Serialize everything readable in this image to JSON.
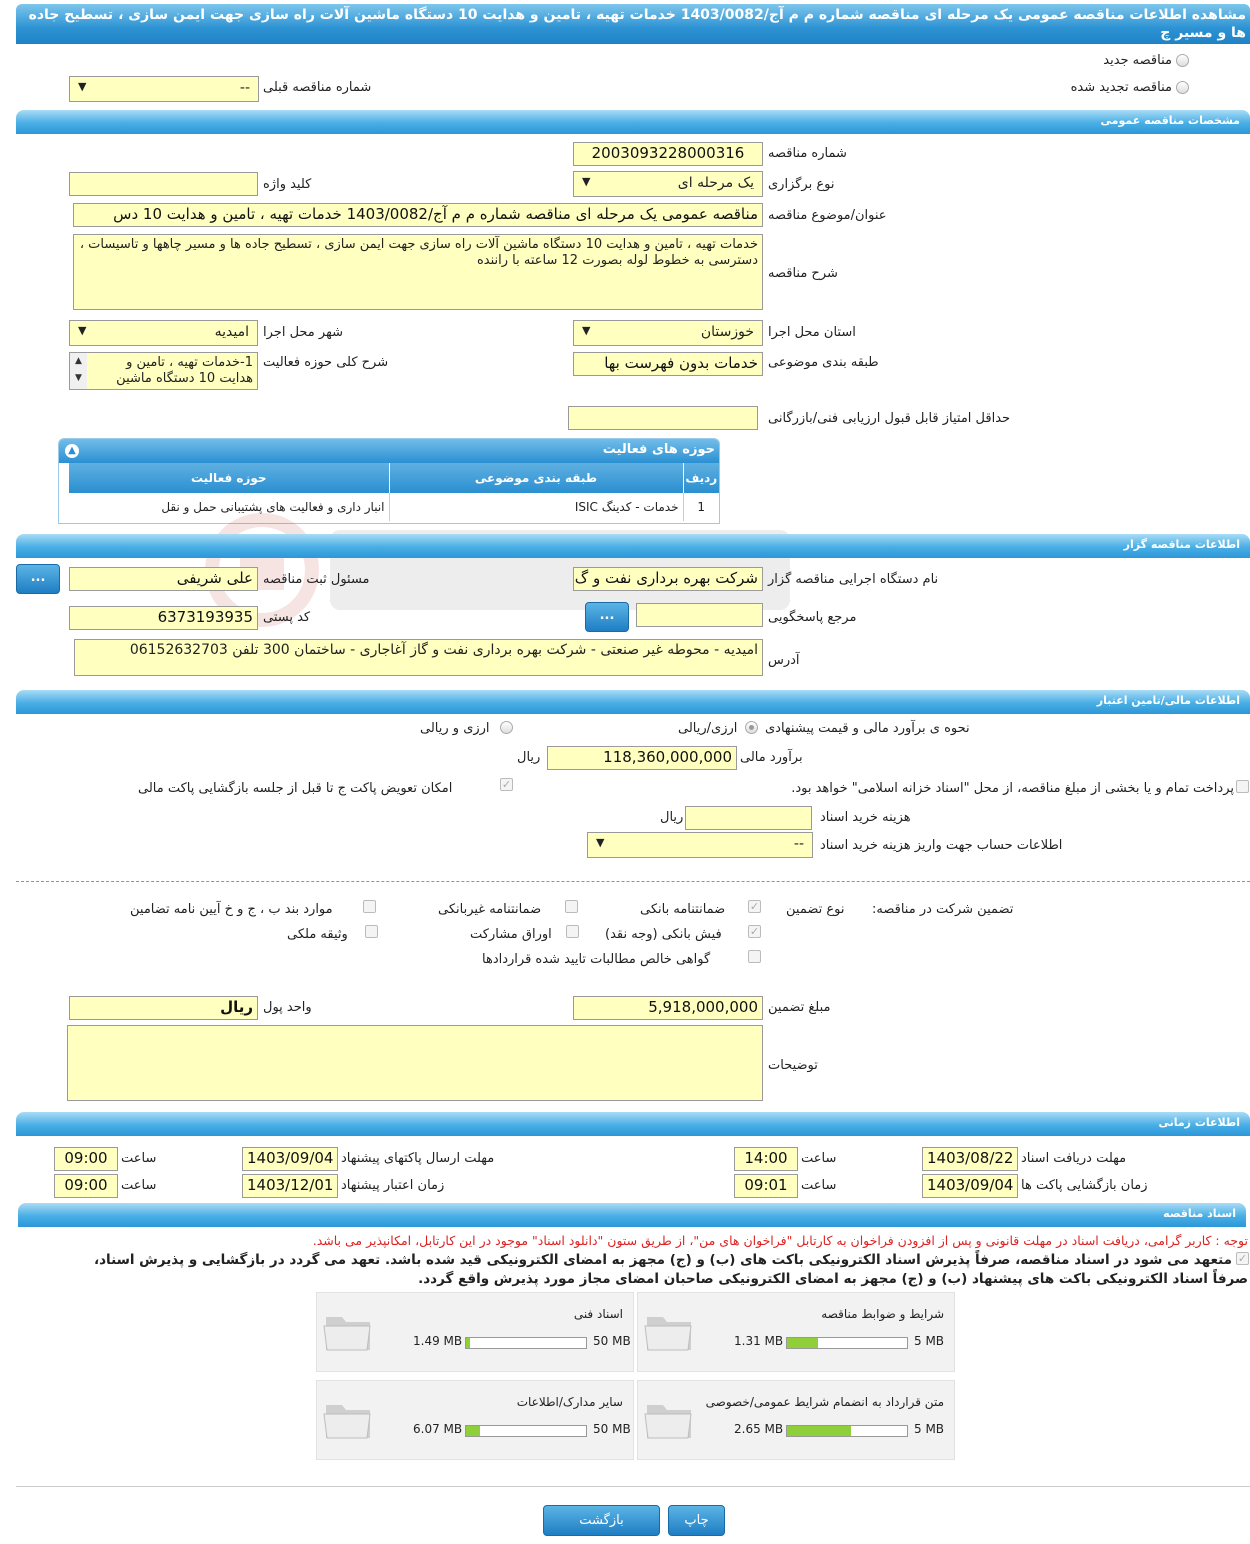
{
  "window_title": "مشاهده اطلاعات مناقصه عمومی یک مرحله ای مناقصه شماره م م آج/1403/0082 خدمات تهیه ، تامین و هدایت 10 دستگاه ماشین آلات راه سازی جهت ایمن سازی ، تسطیح جاده ها و مسیر چ",
  "tender_type": {
    "new_label": "مناقصه جدید",
    "renewed_label": "مناقصه تجدید شده",
    "prev_number_label": "شماره مناقصه قبلی",
    "prev_number_value": "--"
  },
  "general": {
    "section_title": "مشخصات مناقصه عمومی",
    "number_label": "شماره مناقصه",
    "number_value": "2003093228000316",
    "holding_type_label": "نوع برگزاری",
    "holding_type_value": "یک مرحله ای",
    "keyword_label": "کلید واژه",
    "keyword_value": "",
    "subject_label": "عنوان/موضوع مناقصه",
    "subject_value": "مناقصه عمومی یک مرحله ای مناقصه شماره م م آج/1403/0082 خدمات تهیه ، تامین و هدایت 10 دس",
    "description_label": "شرح مناقصه",
    "description_value": "خدمات تهیه ، تامین و هدایت 10 دستگاه ماشین آلات راه سازی جهت ایمن سازی ، تسطیح جاده ها و مسیر چاهها و تاسیسات ، دسترسی به خطوط لوله بصورت 12 ساعته با راننده",
    "province_label": "استان محل اجرا",
    "province_value": "خوزستان",
    "city_label": "شهر محل اجرا",
    "city_value": "امیدیه",
    "category_label": "طبقه بندی موضوعی",
    "category_value": "خدمات بدون فهرست بها",
    "activity_desc_label": "شرح کلی حوزه فعالیت",
    "activity_desc_value": "1-خدمات تهیه ، تامین و هدایت 10 دستگاه ماشین",
    "min_score_label": "حداقل امتیاز قابل قبول ارزیابی فنی/بازرگانی",
    "min_score_value": ""
  },
  "activities": {
    "title": "حوزه های فعالیت",
    "columns": [
      "ردیف",
      "طبقه بندی موضوعی",
      "حوزه فعالیت"
    ],
    "rows": [
      [
        "1",
        "خدمات - کدینگ ISIC",
        "انبار داری و فعالیت های پشتیبانی حمل و نقل"
      ]
    ]
  },
  "organizer": {
    "section_title": "اطلاعات مناقصه گزار",
    "org_label": "نام دستگاه اجرایی مناقصه گزار",
    "org_value": "شرکت بهره برداری نفت و گ",
    "registrar_label": "مسئول ثبت مناقصه",
    "registrar_value": "علی  شریفی",
    "dots": "...",
    "ref_label": "مرجع پاسخگویی",
    "ref_value": "",
    "postal_label": "کد پستی",
    "postal_value": "6373193935",
    "address_label": "آدرس",
    "address_value": "امیدیه - محوطه غیر صنعتی - شرکت بهره برداری نفت و گاز آغاجاری - ساختمان 300 تلفن 06152632703"
  },
  "financial": {
    "section_title": "اطلاعات مالی/تامین اعتبار",
    "method_label": "نحوه ی برآورد مالی و قیمت پیشنهادی",
    "opt1": "ارزی/ریالی",
    "opt2": "ارزی و ریالی",
    "estimate_label": "برآورد مالی",
    "estimate_value": "118,360,000,000",
    "rial": "ریال",
    "treasury_text": "پرداخت تمام و یا بخشی از مبلغ مناقصه، از محل \"اسناد خزانه اسلامی\" خواهد بود.",
    "swap_text": "امکان تعویض پاکت ج تا قبل از جلسه بازگشایی پاکت مالی",
    "doc_cost_label": "هزینه خرید اسناد",
    "doc_cost_value": "",
    "account_label": "اطلاعات حساب جهت واریز هزینه خرید اسناد",
    "account_value": "--"
  },
  "guarantee": {
    "label": "تضمین شرکت در مناقصه:",
    "type_label": "نوع تضمین",
    "options": {
      "bank_guarantee": "ضمانتنامه بانکی",
      "nonbank_guarantee": "ضمانتنامه غیربانکی",
      "items_bpj": "موارد بند ب ، ج و خ آیین نامه تضامین",
      "bank_receipt": "فیش بانکی (وجه نقد)",
      "bonds": "اوراق مشارکت",
      "property": "وثیقه ملکی",
      "certificate": "گواهی خالص مطالبات تایید شده قراردادها"
    },
    "amount_label": "مبلغ تضمین",
    "amount_value": "5,918,000,000",
    "currency_label": "واحد پول",
    "currency_value": "ریال",
    "notes_label": "توضیحات",
    "notes_value": ""
  },
  "timing": {
    "section_title": "اطلاعات زمانی",
    "doc_receive_label": "مهلت دریافت اسناد",
    "doc_receive_date": "1403/08/22",
    "doc_receive_time": "14:00",
    "submit_label": "مهلت ارسال پاکتهای پیشنهاد",
    "submit_date": "1403/09/04",
    "submit_time": "09:00",
    "opening_label": "زمان بازگشایی پاکت ها",
    "opening_date": "1403/09/04",
    "opening_time": "09:01",
    "validity_label": "زمان اعتبار پیشنهاد",
    "validity_date": "1403/12/01",
    "validity_time": "09:00",
    "time_label": "ساعت"
  },
  "documents": {
    "section_title": "اسناد مناقصه",
    "notice": "توجه : کاربر گرامی، دریافت اسناد در مهلت قانونی و پس از افزودن فراخوان به کارتابل \"فراخوان های من\"، از طریق ستون \"دانلود اسناد\" موجود در این کارتابل، امکانپذیر می باشد.",
    "commitment_line1": "متعهد می شود در اسناد مناقصه، صرفاً پذیرش اسناد الکترونیکی باکت های (ب) و (ج) مجهز به امضای الکترونیکی قید شده باشد. تعهد می گردد در بازگشایی و پذیرش اسناد،",
    "commitment_line2": "صرفاً اسناد الکترونیکی باکت های پیشنهاد (ب) و (ج) مجهز به امضای الکترونیکی صاحبان امضای مجاز مورد پذیرش واقع گردد.",
    "files": [
      {
        "name": "شرایط و ضوابط مناقصه",
        "size": "1.31 MB",
        "max": "5 MB",
        "fraction": 0.26
      },
      {
        "name": "اسناد فنی",
        "size": "1.49 MB",
        "max": "50 MB",
        "fraction": 0.03
      },
      {
        "name": "متن قرارداد به انضمام شرایط عمومی/خصوصی",
        "size": "2.65 MB",
        "max": "5 MB",
        "fraction": 0.53
      },
      {
        "name": "سایر مدارک/اطلاعات",
        "size": "6.07 MB",
        "max": "50 MB",
        "fraction": 0.12
      }
    ]
  },
  "footer": {
    "print_label": "چاپ",
    "back_label": "بازگشت"
  }
}
